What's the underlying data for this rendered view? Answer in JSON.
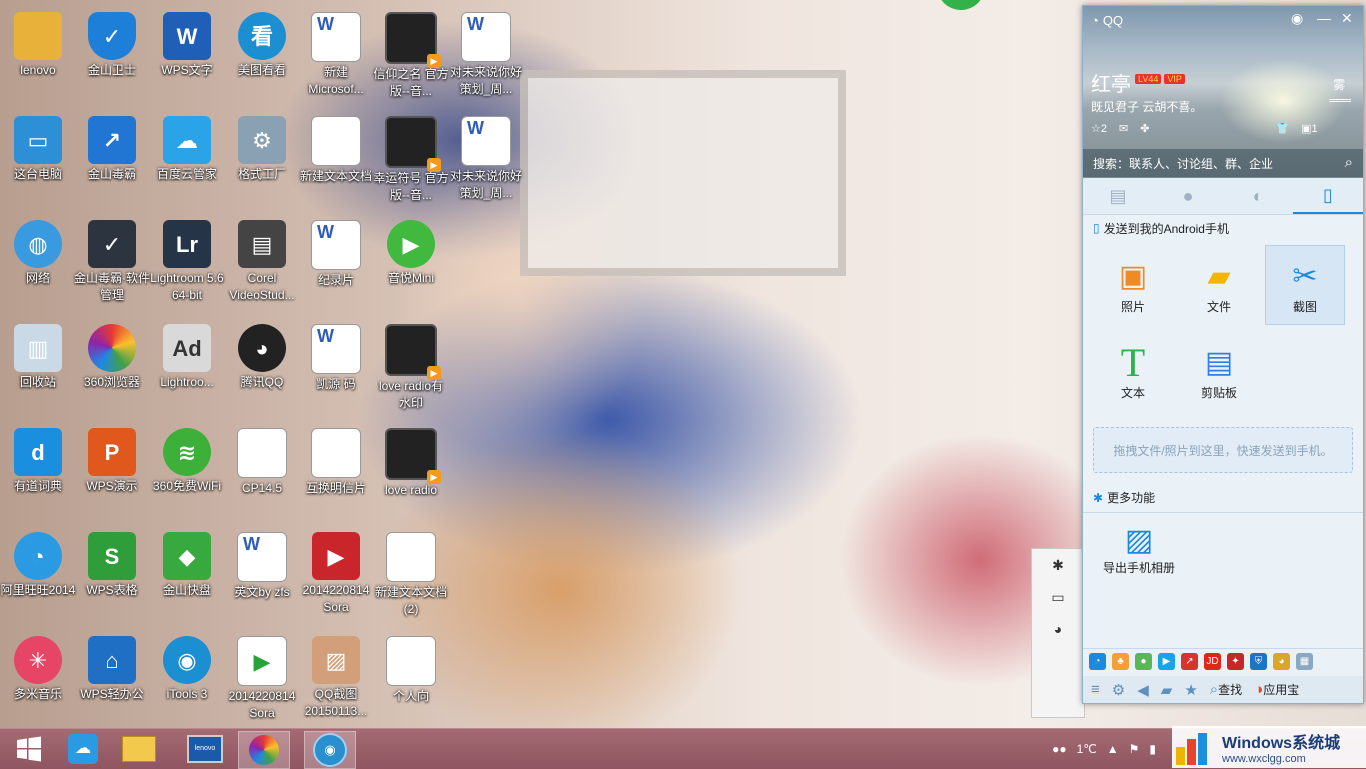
{
  "desktop": {
    "icons": [
      {
        "label": "lenovo",
        "type": "folder"
      },
      {
        "label": "金山卫士",
        "type": "shield"
      },
      {
        "label": "WPS文字",
        "type": "wps-w"
      },
      {
        "label": "美图看看",
        "type": "viewer"
      },
      {
        "label": "新建 Microsof...",
        "type": "doc-w"
      },
      {
        "label": "信仰之名 官方版--音...",
        "type": "video"
      },
      {
        "label": "对未来说你好策划_周...",
        "type": "doc-w"
      },
      {
        "label": "这台电脑",
        "type": "pc"
      },
      {
        "label": "金山毒霸",
        "type": "duba"
      },
      {
        "label": "百度云管家",
        "type": "baidu"
      },
      {
        "label": "格式工厂",
        "type": "factory"
      },
      {
        "label": "新建文本文档",
        "type": "doc"
      },
      {
        "label": "幸运符号 官方版--音...",
        "type": "video"
      },
      {
        "label": "对未来说你好策划_周...",
        "type": "doc-w"
      },
      {
        "label": "网络",
        "type": "network"
      },
      {
        "label": "金山毒霸·软件管理",
        "type": "duba-soft"
      },
      {
        "label": "Lightroom 5.6 64-bit",
        "type": "lr"
      },
      {
        "label": "Corel VideoStud...",
        "type": "corel"
      },
      {
        "label": "纪录片",
        "type": "doc-w"
      },
      {
        "label": "音悦Mini",
        "type": "player"
      },
      {
        "label": "回收站",
        "type": "bin"
      },
      {
        "label": "360浏览器",
        "type": "browser360"
      },
      {
        "label": "Lightroo...",
        "type": "adobe"
      },
      {
        "label": "腾讯QQ",
        "type": "qq"
      },
      {
        "label": "凯源 码",
        "type": "doc-w"
      },
      {
        "label": "love radio有水印",
        "type": "video"
      },
      {
        "label": "有道词典",
        "type": "youdao"
      },
      {
        "label": "WPS演示",
        "type": "wps-p"
      },
      {
        "label": "360免费WiFi",
        "type": "wifi"
      },
      {
        "label": "CP14.5",
        "type": "doc"
      },
      {
        "label": "互换明信片",
        "type": "doc"
      },
      {
        "label": "love radio",
        "type": "video"
      },
      {
        "label": "阿里旺旺2014",
        "type": "wangwang"
      },
      {
        "label": "WPS表格",
        "type": "wps-s"
      },
      {
        "label": "金山快盘",
        "type": "kuaipan"
      },
      {
        "label": "英文by zfs",
        "type": "doc-w"
      },
      {
        "label": "2014220814 Sora",
        "type": "video-red"
      },
      {
        "label": "新建文本文档 (2)",
        "type": "doc"
      },
      {
        "label": "多米音乐",
        "type": "duomi"
      },
      {
        "label": "WPS轻办公",
        "type": "wps-light"
      },
      {
        "label": "iTools 3",
        "type": "itools"
      },
      {
        "label": "2014220814 Sora",
        "type": "doc-green"
      },
      {
        "label": "QQ截图 20150113...",
        "type": "image"
      },
      {
        "label": "个人向",
        "type": "doc"
      }
    ]
  },
  "qq_panel": {
    "title": "QQ",
    "nickname": "红亭",
    "badges": [
      "LV44",
      "VIP"
    ],
    "signature": "既见君子 云胡不喜。",
    "status_counts": {
      "stars": "2",
      "right": "1"
    },
    "weather_icon": "雾",
    "search_placeholder": "搜索：联系人、讨论组、群、企业",
    "tabs": [
      "会话",
      "联系人",
      "群/讨论组",
      "手机"
    ],
    "send_to_phone": "发送到我的Android手机",
    "tiles": [
      {
        "label": "照片",
        "icon": "photo-icon"
      },
      {
        "label": "文件",
        "icon": "folder-icon"
      },
      {
        "label": "截图",
        "icon": "scissors-icon"
      },
      {
        "label": "文本",
        "icon": "text-icon"
      },
      {
        "label": "剪贴板",
        "icon": "clipboard-icon"
      }
    ],
    "drop_hint": "拖拽文件/照片到这里，快速发送到手机。",
    "more_functions": "更多功能",
    "export_album": "导出手机相册",
    "bottom": {
      "search": "查找",
      "appbox": "应用宝"
    }
  },
  "taskbar": {
    "temperature": "1℃"
  },
  "watermark": {
    "title": "Windows系统城",
    "url": "www.wxclgg.com"
  },
  "colors": {
    "taskbar": "#9a5f69",
    "qq_accent": "#1a8ae0"
  }
}
